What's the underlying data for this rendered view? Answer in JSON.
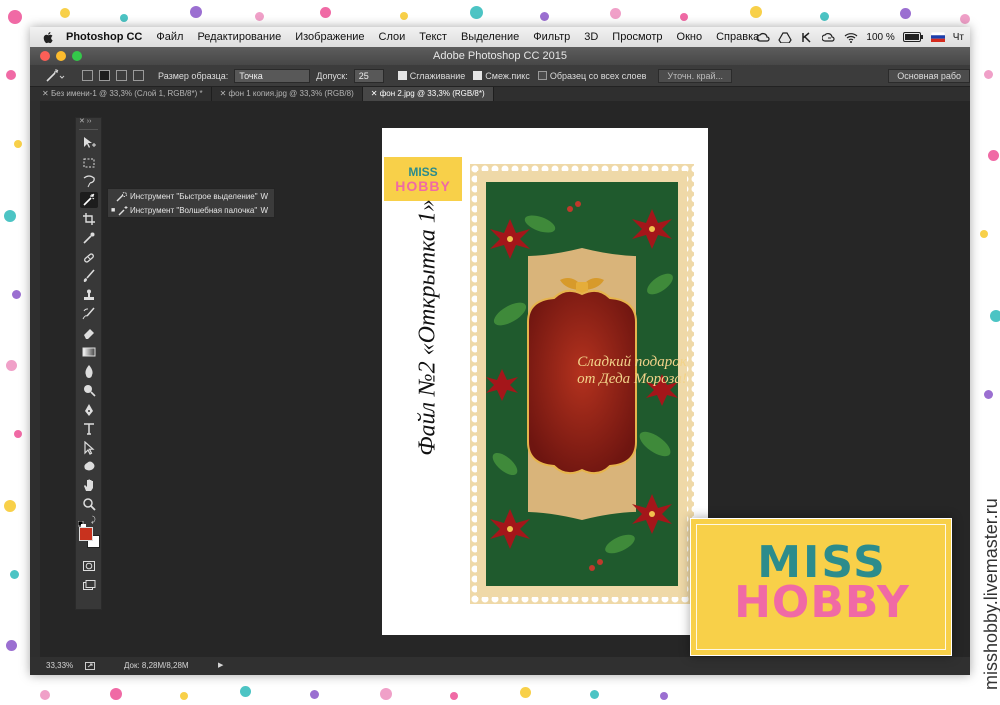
{
  "menubar": {
    "app_name": "Photoshop CC",
    "items": [
      "Файл",
      "Редактирование",
      "Изображение",
      "Слои",
      "Текст",
      "Выделение",
      "Фильтр",
      "3D",
      "Просмотр",
      "Окно",
      "Справка"
    ],
    "battery": "100 %",
    "day": "Чт"
  },
  "window": {
    "title": "Adobe Photoshop CC 2015"
  },
  "options": {
    "sample_size_label": "Размер образца:",
    "sample_size_value": "Точка",
    "tolerance_label": "Допуск:",
    "tolerance_value": "25",
    "antialias_label": "Сглаживание",
    "contiguous_label": "Смеж.пикс",
    "sample_all_label": "Образец со всех слоев",
    "refine_edge_label": "Уточн. край...",
    "workspace_label": "Основная рабо"
  },
  "tabs": [
    {
      "label": "Без имени-1 @ 33,3% (Слой 1, RGB/8*) *",
      "active": false
    },
    {
      "label": "фон 1 копия.jpg @ 33,3% (RGB/8)",
      "active": false
    },
    {
      "label": "фон 2.jpg @ 33,3% (RGB/8*)",
      "active": true
    }
  ],
  "flyout": {
    "items": [
      {
        "label": "Инструмент \"Быстрое выделение\"",
        "key": "W"
      },
      {
        "label": "Инструмент \"Волшебная палочка\"",
        "key": "W"
      }
    ]
  },
  "canvas": {
    "vertical_title": "Файл №2 «Открытка 1»",
    "card_text_line1": "Сладкий подарок",
    "card_text_line2": "от Деда Мороза!",
    "small_logo_line1": "MISS",
    "small_logo_line2": "HOBBY"
  },
  "status": {
    "zoom": "33,33%",
    "doc_info": "Док: 8,28M/8,28M"
  },
  "brand": {
    "logo_line1": "MISS",
    "logo_line2": "HOBBY",
    "watermark": "misshobby.livemaster.ru"
  },
  "colors": {
    "logo_yellow": "#f8d049",
    "logo_teal": "#2c8c8c",
    "logo_pink": "#f06aa5",
    "card_red": "#8b1e14",
    "foreground_swatch": "#c8321e"
  }
}
